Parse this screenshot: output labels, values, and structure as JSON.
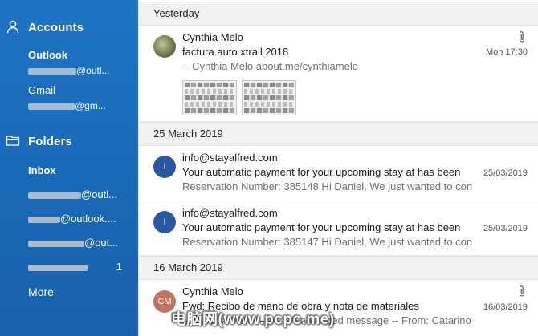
{
  "sidebar": {
    "accounts_label": "Accounts",
    "accounts": [
      {
        "name": "Outlook",
        "email_visible": "@outl...",
        "active": true
      },
      {
        "name": "Gmail",
        "email_visible": "@gm...",
        "active": false
      }
    ],
    "folders_label": "Folders",
    "folders": [
      {
        "name": "Inbox",
        "visible_text": "",
        "count": ""
      },
      {
        "name": "",
        "visible_text": "@outl...",
        "count": ""
      },
      {
        "name": "",
        "visible_text": "@outlook....",
        "count": ""
      },
      {
        "name": "",
        "visible_text": "@out...",
        "count": ""
      },
      {
        "name": "",
        "visible_text": "",
        "count": "1"
      }
    ],
    "more_label": "More"
  },
  "message_list": {
    "groups": [
      {
        "label": "Yesterday",
        "messages": [
          {
            "sender": "Cynthia Melo",
            "subject": "factura auto xtrail 2018",
            "preview": "-- Cynthia Melo about.me/cynthiamelo",
            "date": "Mon 17:30",
            "has_attachment": true,
            "avatar_initials": "",
            "thumbnails": 2
          }
        ]
      },
      {
        "label": "25 March 2019",
        "messages": [
          {
            "sender": "info@stayalfred.com",
            "subject": "Your automatic payment for your upcoming stay at  has been",
            "preview": "Reservation Number: 385148 Hi Daniel, We just wanted to con",
            "date": "25/03/2019",
            "has_attachment": false,
            "avatar_initials": "I"
          },
          {
            "sender": "info@stayalfred.com",
            "subject": "Your automatic payment for your upcoming stay at  has been",
            "preview": "Reservation Number: 385147 Hi Daniel, We just wanted to con",
            "date": "25/03/2019",
            "has_attachment": false,
            "avatar_initials": "I"
          }
        ]
      },
      {
        "label": "16 March 2019",
        "messages": [
          {
            "sender": "Cynthia Melo",
            "subject": "Fwd: Recibo de mano de obra y nota de materiales",
            "preview": "-- Cynthia Melo ---------- Forwarded message -- From: Catarino Villa Solano <catarino",
            "date": "16/03/2019",
            "has_attachment": true,
            "avatar_initials": "CM"
          }
        ]
      }
    ]
  },
  "watermark": "电脑网(www.pcpc.me)",
  "colors": {
    "sidebar_bg": "#1a68b6",
    "group_header_bg": "#f2f2f2",
    "avatar_info": "#2a57a2",
    "avatar_cm": "#c0735f"
  }
}
